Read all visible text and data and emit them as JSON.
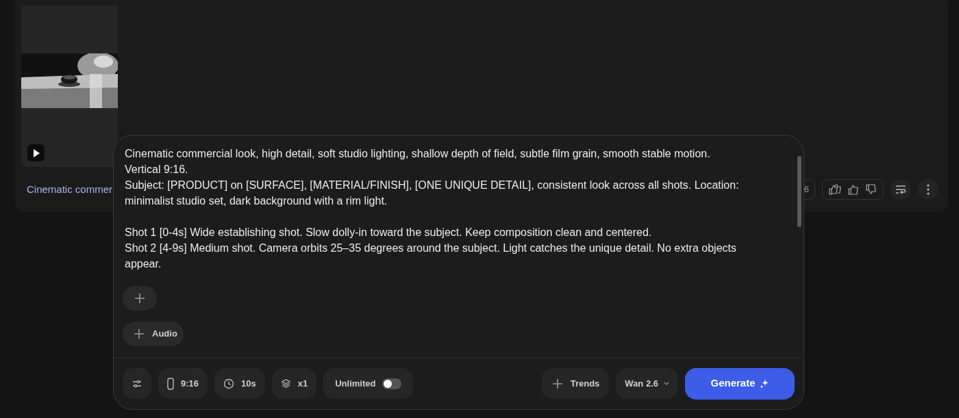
{
  "card": {
    "caption": "Cinematic commer",
    "count_chip": "6"
  },
  "composer": {
    "prompt": [
      {
        "lines": [
          "Cinematic commercial look, high detail, soft studio lighting, shallow depth of field, subtle film grain, smooth stable motion. Vertical 9:16.",
          "Subject: [PRODUCT] on [SURFACE], [MATERIAL/FINISH], [ONE UNIQUE DETAIL], consistent look across all shots. Location: minimalist studio set, dark background with a rim light."
        ]
      },
      {
        "lines": [
          "Shot 1 [0-4s] Wide establishing shot. Slow dolly-in toward the subject. Keep composition clean and centered.",
          "Shot 2 [4-9s] Medium shot. Camera orbits 25–35 degrees around the subject. Light catches the unique detail. No extra objects appear."
        ]
      }
    ],
    "audio_label": "Audio",
    "settings": [
      {
        "kind": "aspect",
        "label": "9:16"
      },
      {
        "kind": "duration",
        "label": "10s"
      },
      {
        "kind": "count",
        "label": "x1"
      }
    ],
    "unlimited": {
      "label": "Unlimited",
      "on": false
    },
    "trends": "Trends",
    "model": "Wan 2.6",
    "generate": "Generate"
  }
}
